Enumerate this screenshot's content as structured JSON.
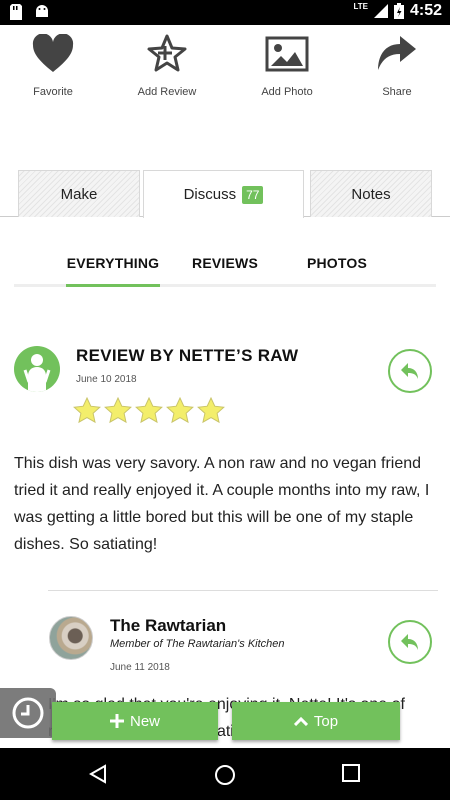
{
  "status_bar": {
    "network": "LTE",
    "time": "4:52"
  },
  "actions": [
    {
      "label": "Favorite",
      "icon": "heart-icon"
    },
    {
      "label": "Add Review",
      "icon": "star-plus-icon"
    },
    {
      "label": "Add Photo",
      "icon": "photo-icon"
    },
    {
      "label": "Share",
      "icon": "share-arrow-icon"
    }
  ],
  "top_tabs": {
    "make": "Make",
    "discuss": "Discuss",
    "discuss_count": "77",
    "notes": "Notes",
    "active": "Discuss"
  },
  "sub_tabs": {
    "everything": "EVERYTHING",
    "reviews": "REVIEWS",
    "photos": "PHOTOS",
    "active": "EVERYTHING"
  },
  "review": {
    "title": "REVIEW BY NETTE’S RAW",
    "date": "June 10 2018",
    "rating": 5,
    "body": "This dish was very savory. A non raw and no vegan friend tried it and really enjoyed it. A couple months into my raw, I was getting a little bored but this will be one of my staple dishes. So satiating!"
  },
  "reply": {
    "name": "The Rawtarian",
    "member": "Member of The Rawtarian's Kitchen",
    "date": "June 11 2018",
    "body": "I'm so glad that you're enjoying it, Nette! It's one of",
    "body_line2": "my favorites too, quite satiating!"
  },
  "buttons": {
    "new": "New",
    "top": "Top"
  },
  "colors": {
    "accent": "#72c15c",
    "star": "#f3ee6b"
  }
}
